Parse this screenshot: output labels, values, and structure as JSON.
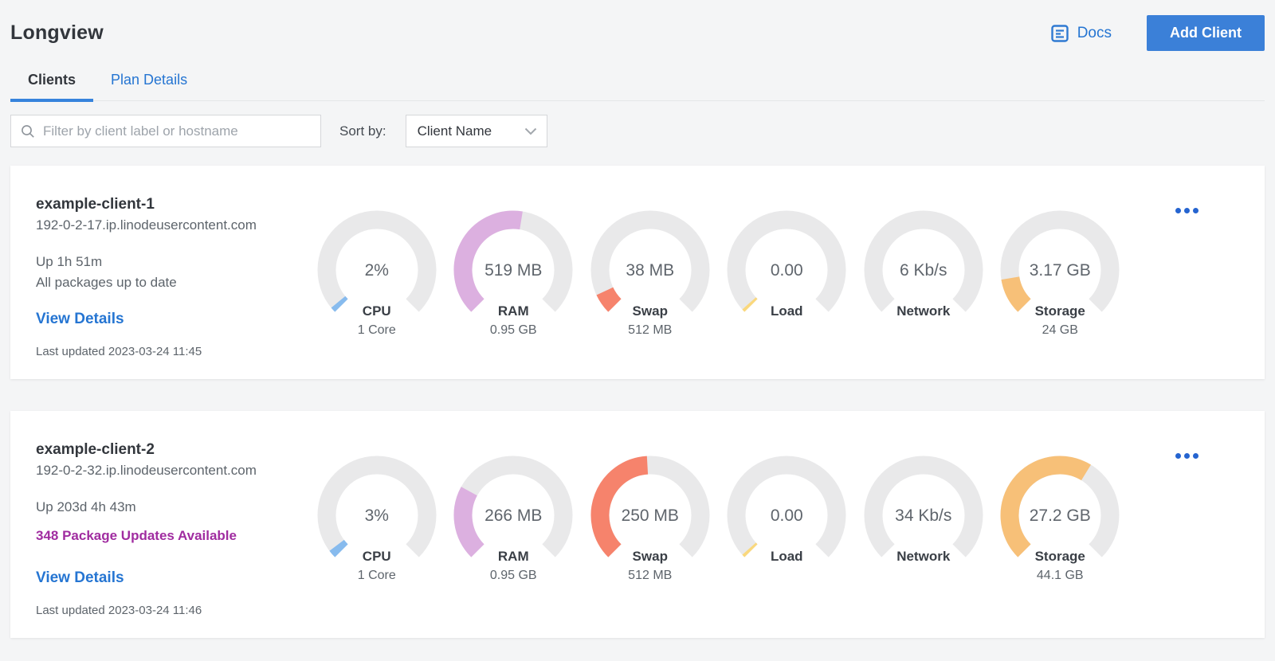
{
  "header": {
    "title": "Longview",
    "docs_label": "Docs",
    "add_client_label": "Add Client"
  },
  "tabs": [
    {
      "label": "Clients",
      "active": true
    },
    {
      "label": "Plan Details",
      "active": false
    }
  ],
  "filter": {
    "placeholder": "Filter by client label or hostname",
    "sort_by_label": "Sort by:",
    "sort_value": "Client Name"
  },
  "colors": {
    "page_bg": "#f4f5f6",
    "accent_blue": "#3b80d8",
    "link_blue": "#2575d2",
    "tab_underline": "#3683dc",
    "text_dark": "#32363c",
    "text_gray": "#5d646b",
    "purple_warning": "#a02ca0",
    "gauge_track": "#e9e9ea"
  },
  "clients": [
    {
      "name": "example-client-1",
      "hostname": "192-0-2-17.ip.linodeusercontent.com",
      "uptime": "Up 1h 51m",
      "packages": "All packages up to date",
      "view_details_label": "View Details",
      "last_updated": "Last updated 2023-03-24 11:45",
      "gauges": [
        {
          "metric": "CPU",
          "value": "2%",
          "sub": "1 Core",
          "fraction": 0.02,
          "color": "#87bbee"
        },
        {
          "metric": "RAM",
          "value": "519 MB",
          "sub": "0.95 GB",
          "fraction": 0.534,
          "color": "#dcb0e0"
        },
        {
          "metric": "Swap",
          "value": "38 MB",
          "sub": "512 MB",
          "fraction": 0.074,
          "color": "#f6836c"
        },
        {
          "metric": "Load",
          "value": "0.00",
          "sub": "",
          "fraction": 0.012,
          "color": "#fad87d"
        },
        {
          "metric": "Network",
          "value": "6 Kb/s",
          "sub": "",
          "fraction": 0,
          "color": "#87bbee"
        },
        {
          "metric": "Storage",
          "value": "3.17 GB",
          "sub": "24 GB",
          "fraction": 0.132,
          "color": "#f7c078"
        }
      ]
    },
    {
      "name": "example-client-2",
      "hostname": "192-0-2-32.ip.linodeusercontent.com",
      "uptime": "Up 203d 4h 43m",
      "packages": "348 Package Updates Available",
      "view_details_label": "View Details",
      "last_updated": "Last updated 2023-03-24 11:46",
      "gauges": [
        {
          "metric": "CPU",
          "value": "3%",
          "sub": "1 Core",
          "fraction": 0.03,
          "color": "#87bbee"
        },
        {
          "metric": "RAM",
          "value": "266 MB",
          "sub": "0.95 GB",
          "fraction": 0.273,
          "color": "#dcb0e0"
        },
        {
          "metric": "Swap",
          "value": "250 MB",
          "sub": "512 MB",
          "fraction": 0.488,
          "color": "#f6836c"
        },
        {
          "metric": "Load",
          "value": "0.00",
          "sub": "",
          "fraction": 0.012,
          "color": "#fad87d"
        },
        {
          "metric": "Network",
          "value": "34 Kb/s",
          "sub": "",
          "fraction": 0,
          "color": "#87bbee"
        },
        {
          "metric": "Storage",
          "value": "27.2 GB",
          "sub": "44.1 GB",
          "fraction": 0.617,
          "color": "#f7c078"
        }
      ]
    }
  ]
}
